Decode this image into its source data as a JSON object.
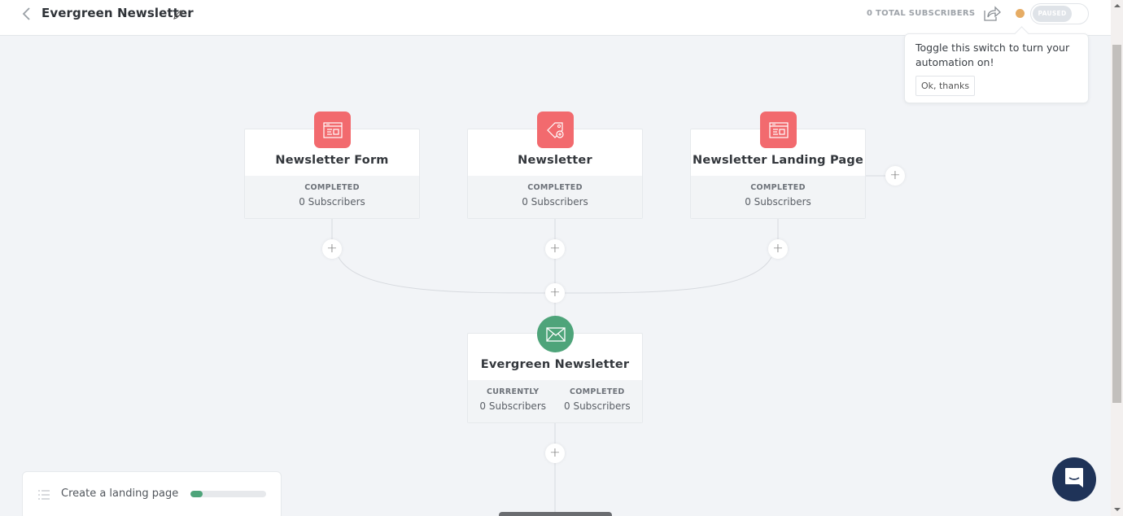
{
  "header": {
    "title": "Evergreen Newsletter",
    "total_subscribers": "0 TOTAL SUBSCRIBERS",
    "toggle_state": "PAUSED",
    "status_color": "#e6ac64"
  },
  "tooltip": {
    "text": "Toggle this switch to turn your automation on!",
    "button": "Ok, thanks"
  },
  "nodes": {
    "entry": [
      {
        "name": "Newsletter Form",
        "icon": "form-icon",
        "stat_label": "COMPLETED",
        "stat_value": "0 Subscribers"
      },
      {
        "name": "Newsletter",
        "icon": "tag-icon",
        "stat_label": "COMPLETED",
        "stat_value": "0 Subscribers"
      },
      {
        "name": "Newsletter Landing Page",
        "icon": "landing-page-icon",
        "stat_label": "COMPLETED",
        "stat_value": "0 Subscribers"
      }
    ],
    "sequence": {
      "name": "Evergreen Newsletter",
      "icon": "envelope-icon",
      "stats": [
        {
          "label": "CURRENTLY",
          "value": "0 Subscribers"
        },
        {
          "label": "COMPLETED",
          "value": "0 Subscribers"
        }
      ]
    }
  },
  "add_step_symbol": "+",
  "checklist": {
    "label": "Create a landing page",
    "progress_percent": 16
  },
  "colors": {
    "entry_badge": "#f26a6e",
    "sequence_badge": "#4ea47a",
    "chat_button": "#1f3358"
  }
}
